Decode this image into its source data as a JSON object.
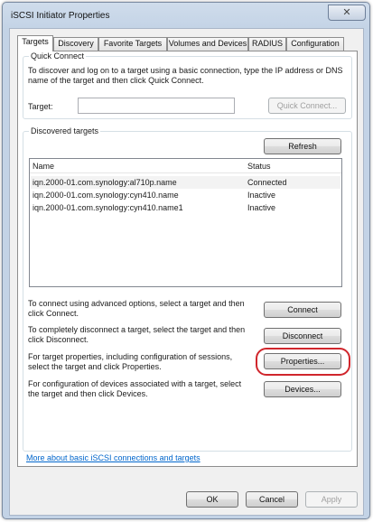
{
  "window": {
    "title": "iSCSI Initiator Properties",
    "close_glyph": "✕"
  },
  "tabs": [
    {
      "label": "Targets"
    },
    {
      "label": "Discovery"
    },
    {
      "label": "Favorite Targets"
    },
    {
      "label": "Volumes and Devices"
    },
    {
      "label": "RADIUS"
    },
    {
      "label": "Configuration"
    }
  ],
  "quick_connect": {
    "title": "Quick Connect",
    "description": "To discover and log on to a target using a basic connection, type the IP address or DNS name of the target and then click Quick Connect.",
    "target_label": "Target:",
    "target_value": "",
    "button": "Quick Connect..."
  },
  "discovered": {
    "title": "Discovered targets",
    "refresh_button": "Refresh",
    "columns": {
      "name": "Name",
      "status": "Status"
    },
    "rows": [
      {
        "name": "iqn.2000-01.com.synology:al710p.name",
        "status": "Connected"
      },
      {
        "name": "iqn.2000-01.com.synology:cyn410.name",
        "status": "Inactive"
      },
      {
        "name": "iqn.2000-01.com.synology:cyn410.name1",
        "status": "Inactive"
      }
    ]
  },
  "actions": [
    {
      "text": "To connect using advanced options, select a target and then click Connect.",
      "button": "Connect"
    },
    {
      "text": "To completely disconnect a target, select the target and then click Disconnect.",
      "button": "Disconnect"
    },
    {
      "text": "For target properties, including configuration of sessions, select the target and click Properties.",
      "button": "Properties..."
    },
    {
      "text": "For configuration of devices associated with a target, select the target and then click Devices.",
      "button": "Devices..."
    }
  ],
  "help_link": "More about basic iSCSI connections and targets",
  "footer": {
    "ok": "OK",
    "cancel": "Cancel",
    "apply": "Apply"
  },
  "colors": {
    "highlight_ring": "#d0262c",
    "link": "#0066cc"
  }
}
